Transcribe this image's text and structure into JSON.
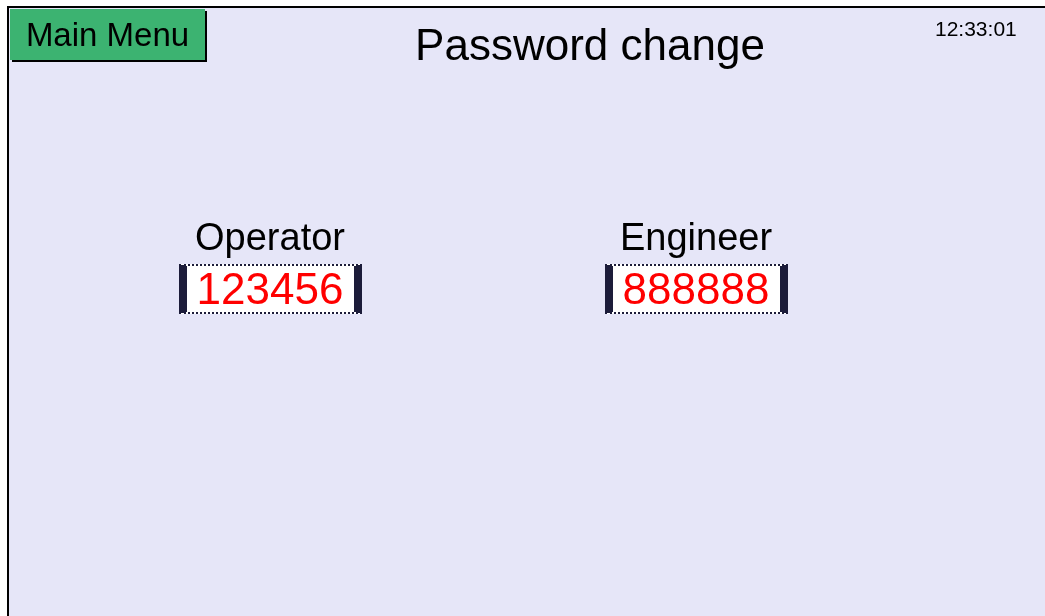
{
  "header": {
    "menu_button": "Main Menu",
    "title": "Password change",
    "clock": "12:33:01"
  },
  "passwords": [
    {
      "label": "Operator",
      "value": "123456"
    },
    {
      "label": "Engineer",
      "value": "888888"
    }
  ]
}
